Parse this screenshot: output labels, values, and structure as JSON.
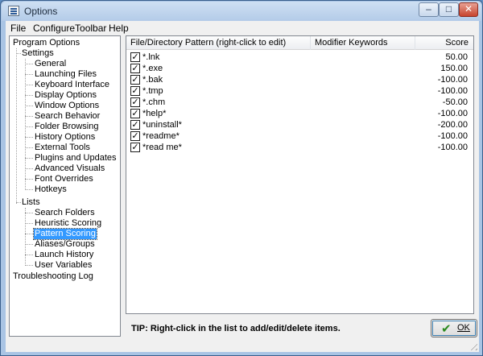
{
  "window": {
    "title": "Options",
    "minimize_glyph": "–",
    "maximize_glyph": "□",
    "close_glyph": "✕"
  },
  "menu": [
    "File",
    "ConfigureToolbar",
    "Help"
  ],
  "tree": {
    "program_options": "Program Options",
    "settings": "Settings",
    "settings_children": [
      "General",
      "Launching Files",
      "Keyboard Interface",
      "Display Options",
      "Window Options",
      "Search Behavior",
      "Folder Browsing",
      "History Options",
      "External Tools",
      "Plugins and Updates",
      "Advanced Visuals",
      "Font Overrides",
      "Hotkeys"
    ],
    "lists": "Lists",
    "lists_children": [
      "Search Folders",
      "Heuristic Scoring",
      "Pattern Scoring",
      "Aliases/Groups",
      "Launch History",
      "User Variables"
    ],
    "selected": "Pattern Scoring",
    "troubleshooting": "Troubleshooting Log"
  },
  "list": {
    "columns": {
      "pattern": "File/Directory Pattern (right-click to edit)",
      "keywords": "Modifier Keywords",
      "score": "Score"
    },
    "rows": [
      {
        "checked": true,
        "pattern": "*.lnk",
        "keywords": "",
        "score": "50.00"
      },
      {
        "checked": true,
        "pattern": "*.exe",
        "keywords": "",
        "score": "150.00"
      },
      {
        "checked": true,
        "pattern": "*.bak",
        "keywords": "",
        "score": "-100.00"
      },
      {
        "checked": true,
        "pattern": "*.tmp",
        "keywords": "",
        "score": "-100.00"
      },
      {
        "checked": true,
        "pattern": "*.chm",
        "keywords": "",
        "score": "-50.00"
      },
      {
        "checked": true,
        "pattern": "*help*",
        "keywords": "",
        "score": "-100.00"
      },
      {
        "checked": true,
        "pattern": "*uninstall*",
        "keywords": "",
        "score": "-200.00"
      },
      {
        "checked": true,
        "pattern": "*readme*",
        "keywords": "",
        "score": "-100.00"
      },
      {
        "checked": true,
        "pattern": "*read me*",
        "keywords": "",
        "score": "-100.00"
      }
    ]
  },
  "footer": {
    "tip": "TIP: Right-click in the list to add/edit/delete items.",
    "ok_label": "OK"
  },
  "colors": {
    "selection": "#3399ff",
    "frame": "#a9c4e4",
    "ok_check": "#2a8a1e"
  }
}
